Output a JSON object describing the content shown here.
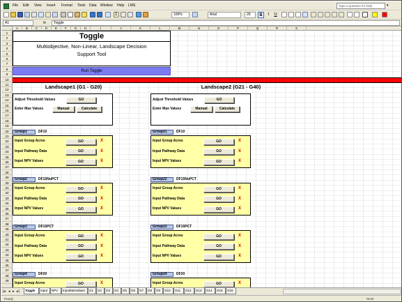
{
  "menubar": {
    "items": [
      "File",
      "Edit",
      "View",
      "Insert",
      "Format",
      "Tools",
      "Data",
      "Window",
      "Help",
      "LMS"
    ],
    "help_placeholder": "Type a question for help"
  },
  "toolbar": {
    "zoom": "100%",
    "font": "Arial",
    "font_size": "26",
    "bold": "B",
    "italic": "I",
    "underline": "U"
  },
  "formula_bar": {
    "name_box": "A1",
    "fx": "fx",
    "content": "Toggle"
  },
  "columns": [
    "A",
    "B",
    "C",
    "D",
    "E",
    "F",
    "G",
    "H",
    "I",
    "J",
    "K",
    "L",
    "M",
    "N",
    "O",
    "P",
    "Q",
    "R",
    "S"
  ],
  "rows": [
    "1",
    "2",
    "3",
    "4",
    "5",
    "6",
    "7",
    "8",
    "9",
    "10",
    "11",
    "12",
    "13",
    "14",
    "15",
    "16",
    "17",
    "18",
    "19",
    "20",
    "21",
    "22",
    "23",
    "24",
    "25",
    "26",
    "27",
    "28",
    "29",
    "30",
    "31",
    "32",
    "33",
    "34",
    "35",
    "36",
    "37",
    "38",
    "39",
    "40",
    "41",
    "42",
    "43",
    "44",
    "45",
    "46",
    "47",
    "48",
    "49"
  ],
  "sheet": {
    "title": "Toggle",
    "subtitle_line1": "Multiobjective, Non-Linear, Landscape Decision",
    "subtitle_line2": "Support Tool",
    "run_button": "Run Toggle",
    "landscapes": [
      {
        "title": "Landscape1 (G1 - G20)",
        "adjust_label": "Adjust Threshold Values",
        "adjust_button": "GO",
        "max_label": "Enter Max Values",
        "manual_button": "Manual",
        "calculate_button": "Calculate",
        "groups": [
          {
            "tag": "Group1",
            "name": "DF10"
          },
          {
            "tag": "Group2",
            "name": "DF15NoPCT"
          },
          {
            "tag": "Group3",
            "name": "DF15PCT"
          },
          {
            "tag": "Group4",
            "name": "DF20"
          }
        ]
      },
      {
        "title": "Landscape2 (G21 - G40)",
        "adjust_label": "Adjust Threshold Values",
        "adjust_button": "GO",
        "max_label": "Enter Max Values",
        "manual_button": "Manual",
        "calculate_button": "Calculate",
        "groups": [
          {
            "tag": "Group21",
            "name": "DF10"
          },
          {
            "tag": "Group22",
            "name": "DF15NoPCT"
          },
          {
            "tag": "Group23",
            "name": "DF15PCT"
          },
          {
            "tag": "Group24",
            "name": "DF20"
          }
        ]
      }
    ],
    "group_rows": [
      "Input Group Acres",
      "Input Pathway Data",
      "Input NPV Values"
    ],
    "go_label": "GO",
    "x_mark": "X"
  },
  "tabs": [
    "Toggle",
    "Input",
    "NPV",
    "InputMaxValues",
    "G1",
    "G2",
    "G3",
    "G4",
    "G5",
    "G6",
    "G7",
    "G8",
    "G9",
    "G10",
    "G11",
    "G12",
    "G13",
    "G14",
    "G15",
    "G16"
  ],
  "status": {
    "left": "Ready",
    "right": "NUM"
  }
}
